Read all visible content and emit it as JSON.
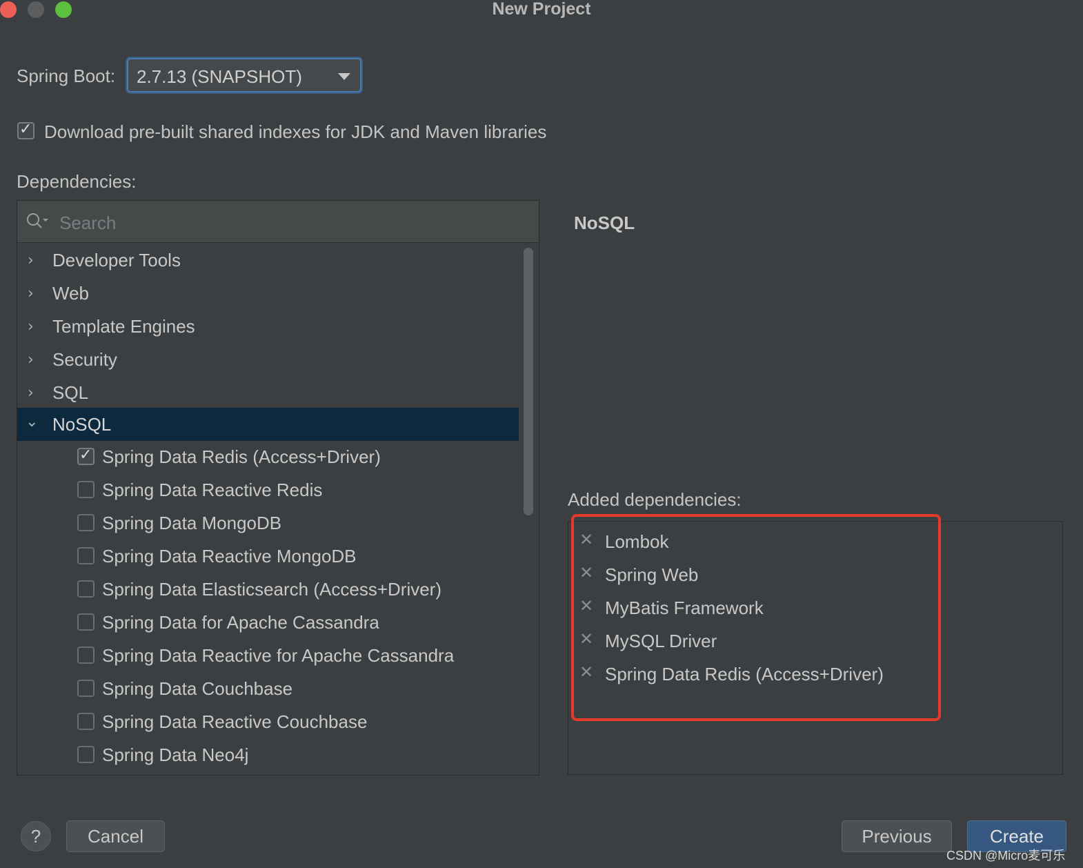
{
  "window": {
    "title": "New Project",
    "traffic_colors": [
      "#ec5f57",
      "#5b5d5f",
      "#5ec03f"
    ]
  },
  "spring_boot": {
    "label": "Spring Boot:",
    "selected": "2.7.13 (SNAPSHOT)"
  },
  "download_indexes": {
    "checked": true,
    "label": "Download pre-built shared indexes for JDK and Maven libraries"
  },
  "dependencies": {
    "label": "Dependencies:",
    "search_placeholder": "Search",
    "categories": [
      {
        "label": "Developer Tools",
        "expanded": false
      },
      {
        "label": "Web",
        "expanded": false
      },
      {
        "label": "Template Engines",
        "expanded": false
      },
      {
        "label": "Security",
        "expanded": false
      },
      {
        "label": "SQL",
        "expanded": false
      },
      {
        "label": "NoSQL",
        "expanded": true,
        "selected": true
      }
    ],
    "nosql_items": [
      {
        "label": "Spring Data Redis (Access+Driver)",
        "checked": true
      },
      {
        "label": "Spring Data Reactive Redis",
        "checked": false
      },
      {
        "label": "Spring Data MongoDB",
        "checked": false
      },
      {
        "label": "Spring Data Reactive MongoDB",
        "checked": false
      },
      {
        "label": "Spring Data Elasticsearch (Access+Driver)",
        "checked": false
      },
      {
        "label": "Spring Data for Apache Cassandra",
        "checked": false
      },
      {
        "label": "Spring Data Reactive for Apache Cassandra",
        "checked": false
      },
      {
        "label": "Spring Data Couchbase",
        "checked": false
      },
      {
        "label": "Spring Data Reactive Couchbase",
        "checked": false
      },
      {
        "label": "Spring Data Neo4j",
        "checked": false
      }
    ]
  },
  "detail": {
    "heading": "NoSQL"
  },
  "added": {
    "label": "Added dependencies:",
    "items": [
      "Lombok",
      "Spring Web",
      "MyBatis Framework",
      "MySQL Driver",
      "Spring Data Redis (Access+Driver)"
    ]
  },
  "footer": {
    "help": "?",
    "cancel": "Cancel",
    "previous": "Previous",
    "create": "Create"
  },
  "watermark": "CSDN @Micro麦可乐",
  "colors": {
    "background": "#3c3f41",
    "selection": "#0d293e",
    "primary_button": "#365880",
    "highlight_border": "#e5392a"
  }
}
